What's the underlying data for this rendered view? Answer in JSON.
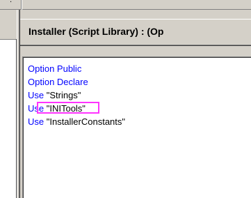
{
  "tab": {
    "glyph": "·"
  },
  "header": {
    "title": "Installer (Script Library) : (Op"
  },
  "code": {
    "lines": [
      {
        "keyword": "Option Public",
        "rest": ""
      },
      {
        "keyword": "Option Declare",
        "rest": ""
      },
      {
        "keyword": "Use",
        "rest": " \"Strings\""
      },
      {
        "keyword": "Use",
        "rest": " \"INITools\""
      },
      {
        "keyword": "Use",
        "rest": " \"InstallerConstants\""
      }
    ],
    "highlighted_line_index": 3
  },
  "colors": {
    "keyword": "#0000ff",
    "text": "#000000",
    "highlight_box": "#ff33ff",
    "chrome": "#d4d0c8"
  }
}
